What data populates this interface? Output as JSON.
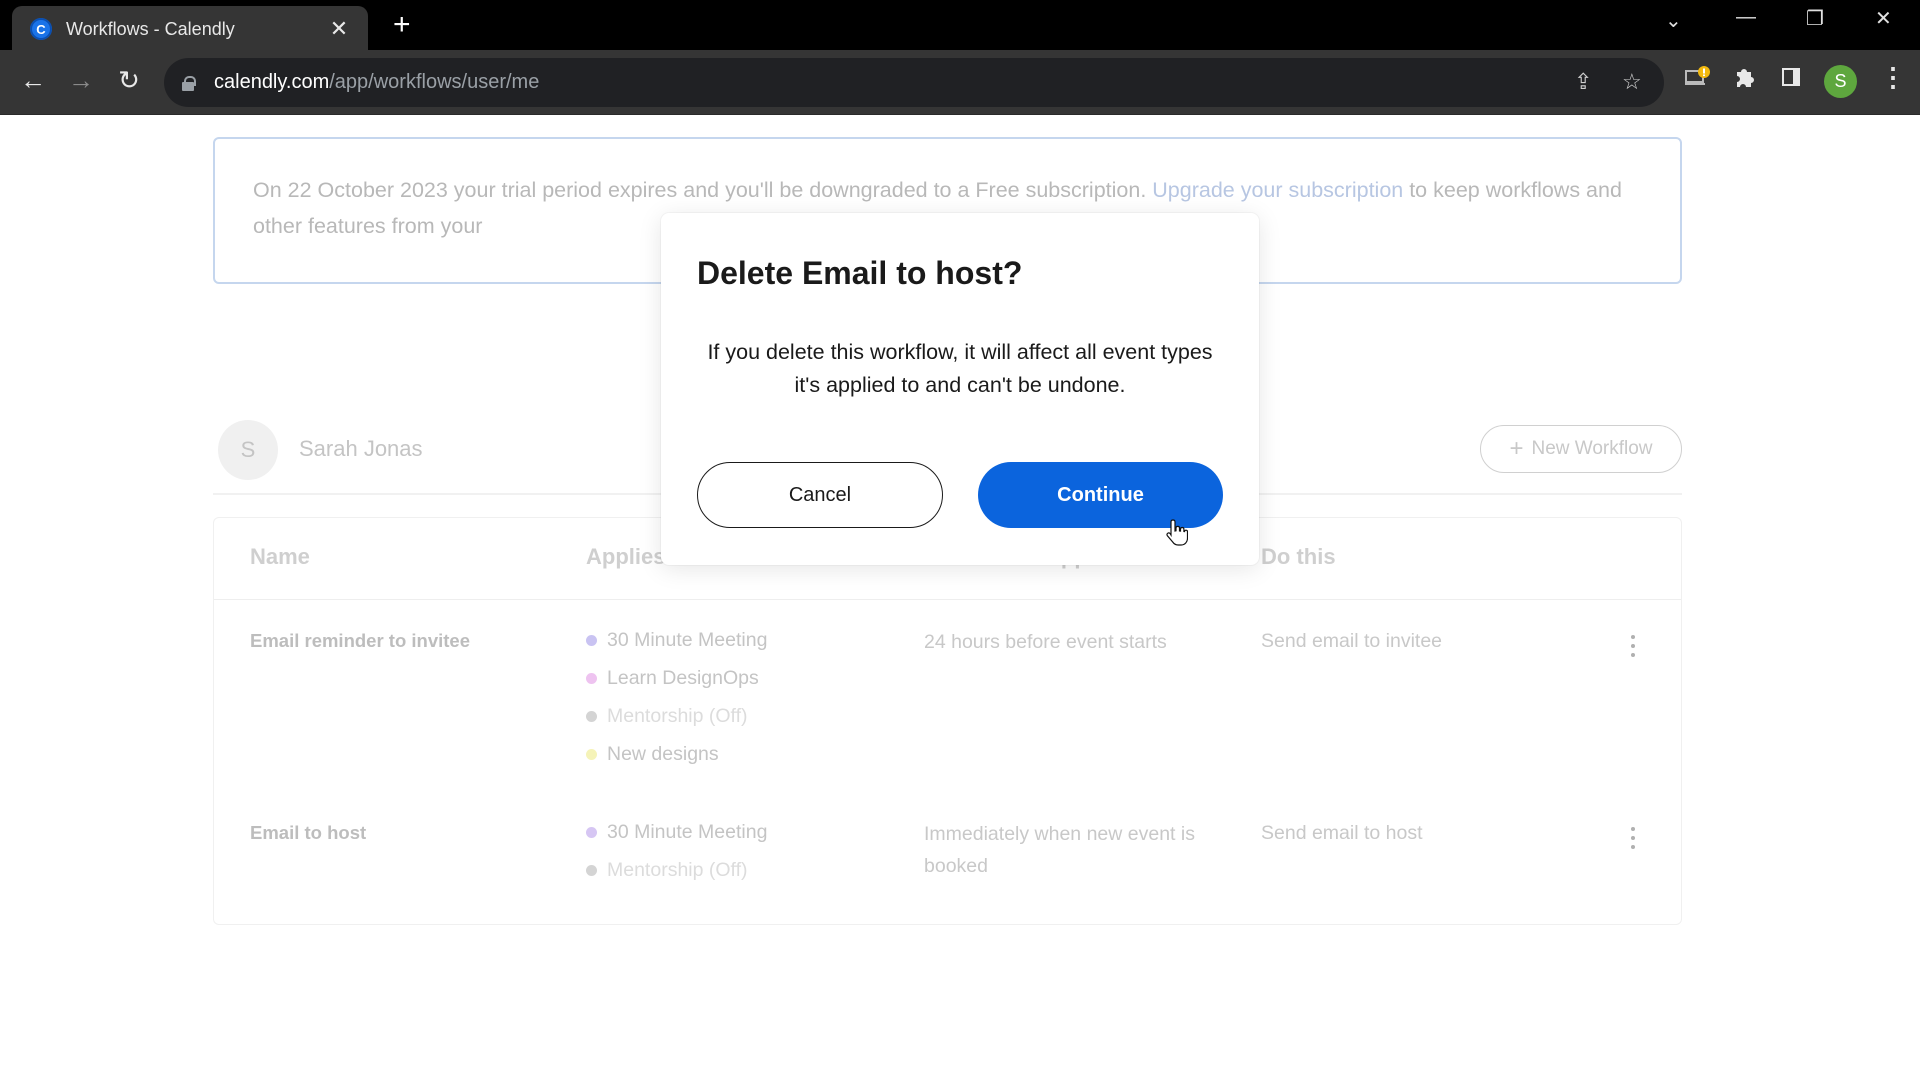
{
  "browser": {
    "tab_title": "Workflows - Calendly",
    "favicon_letter": "C",
    "url_host": "calendly.com",
    "url_path": "/app/workflows/user/me",
    "profile_initial": "S",
    "icons": {
      "back": "←",
      "forward": "→",
      "reload": "↻",
      "share": "⇪",
      "bookmark": "☆",
      "extension_alert": "!",
      "extensions": "puzzle",
      "sidepanel": "▮",
      "menu": "⋮",
      "tab_search": "⌄",
      "minimize": "—",
      "restore": "❐",
      "close": "✕",
      "new_tab": "+",
      "tab_close": "✕"
    }
  },
  "banner": {
    "text_before": "On 22 October 2023 your trial period expires and you'll be downgraded to a Free subscription. ",
    "link_text": "Upgrade your subscription",
    "text_after": " to keep workflows and other features from your"
  },
  "user": {
    "avatar_initial": "S",
    "name": "Sarah Jonas",
    "new_workflow_label": "New Workflow"
  },
  "table": {
    "headers": [
      "Name",
      "Applies to",
      "When this happens",
      "Do this"
    ],
    "rows": [
      {
        "name": "Email reminder to invitee",
        "applies_to": [
          {
            "label": "30 Minute Meeting",
            "color": "#c9c3f2",
            "off": false
          },
          {
            "label": "Learn DesignOps",
            "color": "#eec3f0",
            "off": false
          },
          {
            "label": "Mentorship (Off)",
            "color": "#d4d4d4",
            "off": true
          },
          {
            "label": "New designs",
            "color": "#f5f3b8",
            "off": false
          }
        ],
        "when": "24 hours before event starts",
        "action": "Send email to invitee"
      },
      {
        "name": "Email to host",
        "applies_to": [
          {
            "label": "30 Minute Meeting",
            "color": "#d6c6f3",
            "off": false
          },
          {
            "label": "Mentorship (Off)",
            "color": "#d4d4d4",
            "off": true
          }
        ],
        "when": "Immediately when new event is booked",
        "action": "Send email to host"
      }
    ]
  },
  "modal": {
    "title": "Delete Email to host?",
    "body": "If you delete this workflow, it will affect all event types it's applied to and can't be undone.",
    "cancel_label": "Cancel",
    "continue_label": "Continue",
    "continue_color": "#0b64dd"
  }
}
